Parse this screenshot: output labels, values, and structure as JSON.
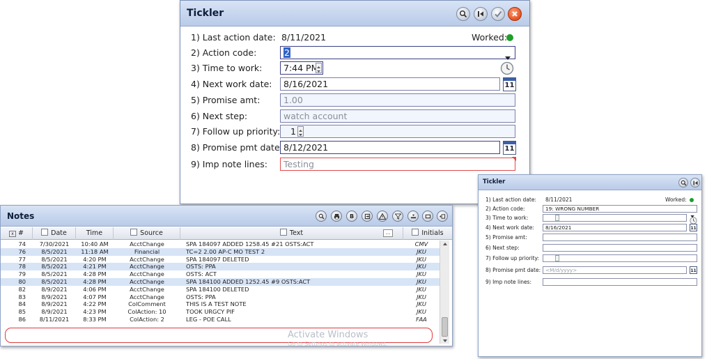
{
  "tickler": {
    "title": "Tickler",
    "worked_label": "Worked:",
    "worked_color": "#1f9e2a",
    "fields": [
      {
        "label": "1) Last action date:",
        "value": "8/11/2021"
      },
      {
        "label": "2) Action code:",
        "value": "2"
      },
      {
        "label": "3) Time to work:",
        "value": "7:44 PM"
      },
      {
        "label": "4) Next work date:",
        "value": "8/16/2021"
      },
      {
        "label": "5) Promise amt:",
        "value": "1.00"
      },
      {
        "label": "6) Next step:",
        "value": "watch account"
      },
      {
        "label": "7) Follow up priority:",
        "value": "1"
      },
      {
        "label": "8) Promise pmt date:",
        "value": "8/12/2021"
      },
      {
        "label": "9) Imp note lines:",
        "value": "Testing"
      }
    ],
    "calendar_label": "11"
  },
  "tickler_small": {
    "title": "Tickler",
    "worked_label": "Worked:",
    "fields": [
      {
        "label": "1) Last action date:",
        "value": "8/11/2021"
      },
      {
        "label": "2) Action code:",
        "value": "19: WRONG NUMBER"
      },
      {
        "label": "3) Time to work:",
        "value": ""
      },
      {
        "label": "4) Next work date:",
        "value": "8/16/2021"
      },
      {
        "label": "5) Promise amt:",
        "value": ""
      },
      {
        "label": "6) Next step:",
        "value": ""
      },
      {
        "label": "7) Follow up priority:",
        "value": ""
      },
      {
        "label": "8) Promise pmt date:",
        "value": "",
        "placeholder": "<M/d/yyyy>"
      },
      {
        "label": "9) Imp note lines:",
        "value": ""
      }
    ],
    "calendar_label": "11"
  },
  "notes": {
    "title": "Notes",
    "toolbar_letter": "B",
    "columns": {
      "num": "#",
      "date": "Date",
      "time": "Time",
      "source": "Source",
      "text": "Text",
      "text_more": "...",
      "initials": "Initials"
    },
    "rows": [
      {
        "num": "74",
        "date": "7/30/2021",
        "time": "10:40 AM",
        "source": "AcctChange",
        "text": "SPA 184097 ADDED 1258.45 #21 OSTS:ACT",
        "initials": "CMV"
      },
      {
        "num": "76",
        "date": "8/5/2021",
        "time": "11:18 AM",
        "source": "Financial",
        "text": "TC=2 2.00 AP-C MO TEST 2",
        "initials": "JKU"
      },
      {
        "num": "77",
        "date": "8/5/2021",
        "time": "4:20 PM",
        "source": "AcctChange",
        "text": "SPA 184097 DELETED",
        "initials": "JKU"
      },
      {
        "num": "78",
        "date": "8/5/2021",
        "time": "4:21 PM",
        "source": "AcctChange",
        "text": "OSTS: PPA",
        "initials": "JKU"
      },
      {
        "num": "79",
        "date": "8/5/2021",
        "time": "4:28 PM",
        "source": "AcctChange",
        "text": "OSTS: ACT",
        "initials": "JKU"
      },
      {
        "num": "80",
        "date": "8/5/2021",
        "time": "4:28 PM",
        "source": "AcctChange",
        "text": "SPA 184100 ADDED 1252.45 #9 OSTS:ACT",
        "initials": "JKU"
      },
      {
        "num": "82",
        "date": "8/9/2021",
        "time": "4:06 PM",
        "source": "AcctChange",
        "text": "SPA 184100 DELETED",
        "initials": "JKU"
      },
      {
        "num": "83",
        "date": "8/9/2021",
        "time": "4:07 PM",
        "source": "AcctChange",
        "text": "OSTS: PPA",
        "initials": "JKU"
      },
      {
        "num": "84",
        "date": "8/9/2021",
        "time": "4:22 PM",
        "source": "ColComment",
        "text": "THIS IS A TEST NOTE",
        "initials": "JKU"
      },
      {
        "num": "85",
        "date": "8/9/2021",
        "time": "4:23 PM",
        "source": "ColAction: 10",
        "text": "TOOK URGCY PIF",
        "initials": "JKU"
      },
      {
        "num": "86",
        "date": "8/11/2021",
        "time": "8:33 PM",
        "source": "ColAction: 2",
        "text": "LEG - POE CALL",
        "initials": "FAA"
      }
    ],
    "watermark": "Activate Windows",
    "watermark_sub": "Go to Settings to activate Windows."
  },
  "colors": {
    "accent_ring": "#e03838",
    "selected_row": "#d7e4f6",
    "worked_dot": "#1f9e2a"
  }
}
